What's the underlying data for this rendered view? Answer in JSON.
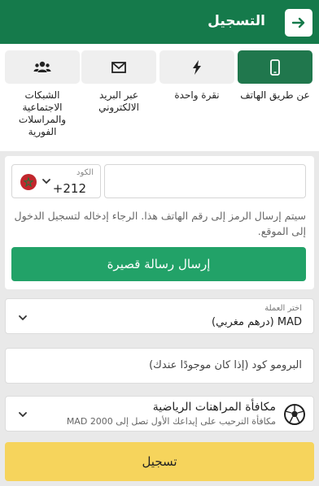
{
  "header": {
    "title": "التسجيل",
    "back_icon": "arrow-right-icon"
  },
  "tabs": [
    {
      "label": "عن طريق الهاتف",
      "icon": "phone-icon",
      "active": true
    },
    {
      "label": "نقرة واحدة",
      "icon": "lightning-icon",
      "active": false
    },
    {
      "label": "عبر البريد الالكتروني",
      "icon": "envelope-icon",
      "active": false
    },
    {
      "label": "الشبكات الاجتماعية والمراسلات الفورية",
      "icon": "users-icon",
      "active": false
    }
  ],
  "phone": {
    "code_label": "الكود",
    "code_value": "+212",
    "flag": "morocco-flag-icon",
    "number_value": "",
    "hint": "سيتم إرسال الرمز إلى رقم الهاتف هذا. الرجاء إدخاله لتسجيل الدخول إلى الموقع.",
    "send_button": "إرسال رسالة قصيرة"
  },
  "currency": {
    "label": "اختر العملة",
    "value": "MAD  (درهم مغربي)"
  },
  "promo": {
    "placeholder": "البرومو كود (إذا كان موجودًا عندك)"
  },
  "bonus": {
    "title": "مكافأة المراهنات الرياضية",
    "subtitle": "مكافأة الترحيب على إيداعك الأول تصل إلى 2000 MAD",
    "icon": "soccer-ball-icon"
  },
  "register_button": "تسجيل",
  "colors": {
    "primary": "#157a4b",
    "active_tab": "#20774d",
    "send_button": "#22a268",
    "register_button": "#f6d45c",
    "background": "#e9e9e9"
  }
}
